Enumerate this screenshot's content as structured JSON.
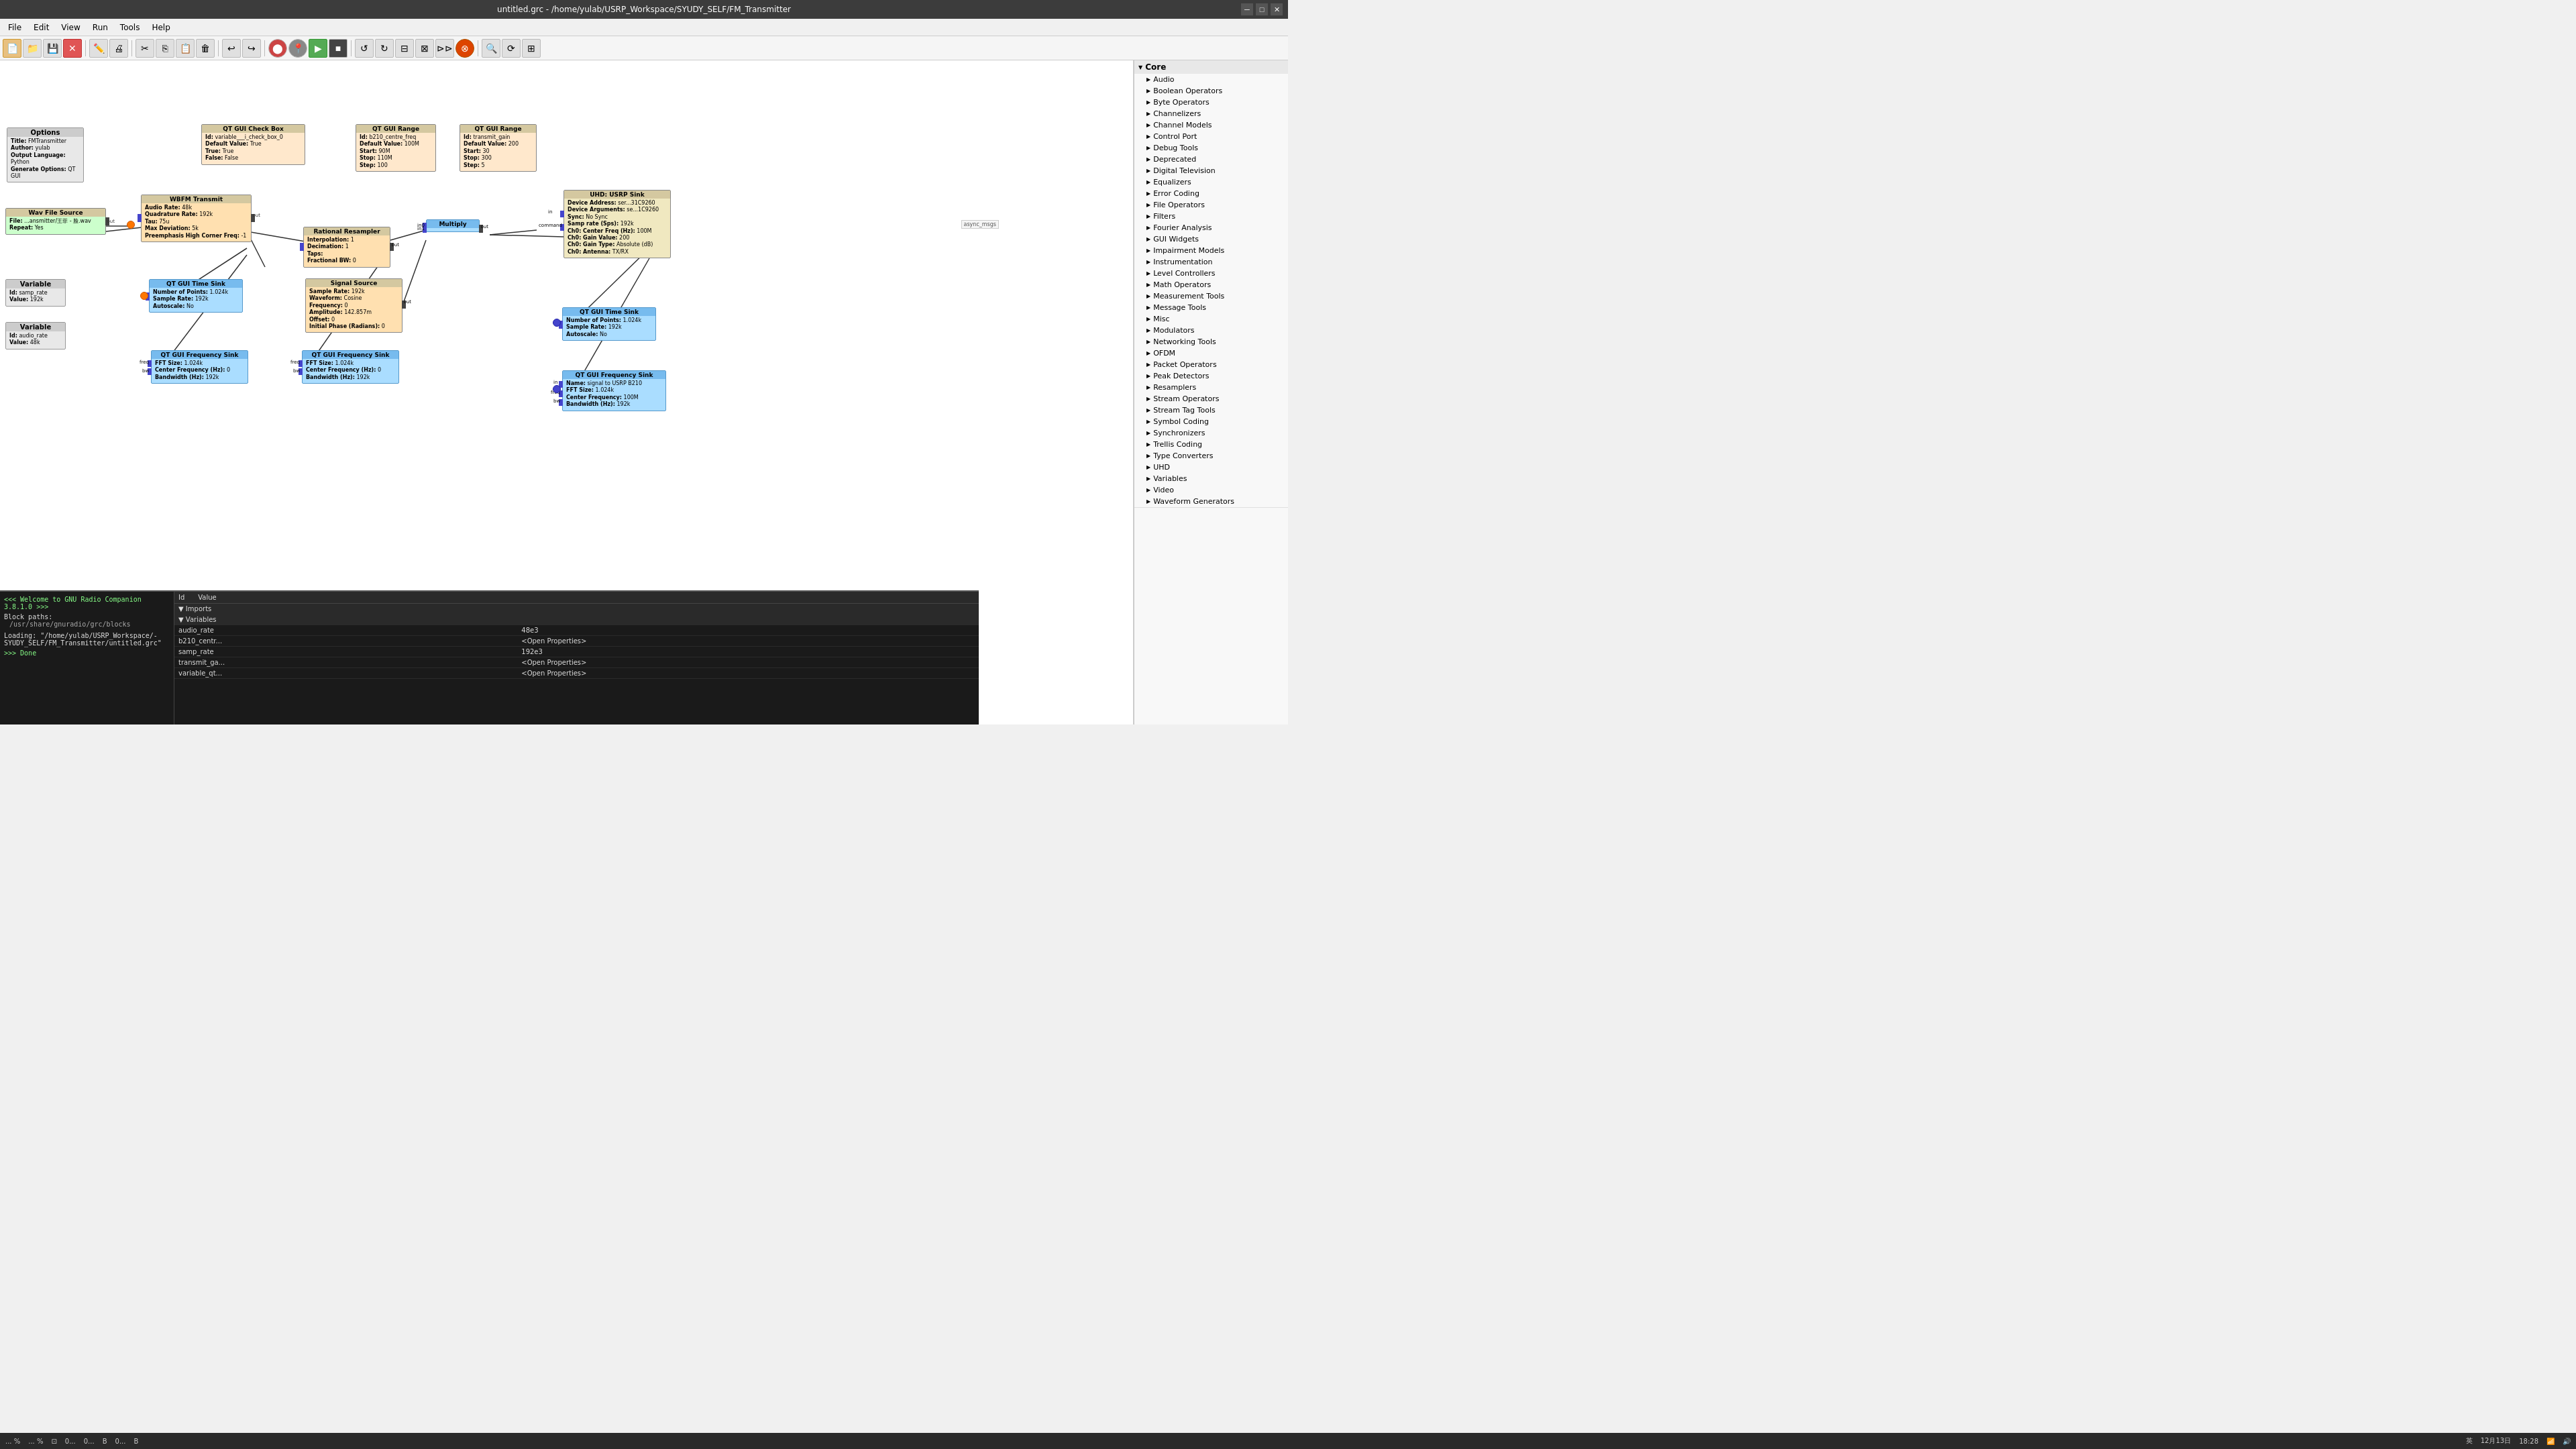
{
  "window": {
    "title": "untitled.grc - /home/yulab/USRP_Workspace/SYUDY_SELF/FM_Transmitter"
  },
  "menubar": {
    "items": [
      "File",
      "Edit",
      "View",
      "Run",
      "Tools",
      "Help"
    ]
  },
  "toolbar": {
    "buttons": [
      "new",
      "open",
      "save",
      "close",
      "edit",
      "print",
      "cut",
      "copy",
      "paste",
      "delete",
      "undo",
      "redo",
      "stop",
      "enable",
      "play",
      "stop2",
      "skip",
      "back",
      "forward",
      "rotate-left",
      "rotate-right",
      "connect",
      "disconnect",
      "search",
      "refresh",
      "align"
    ]
  },
  "blocks": {
    "options": {
      "title": "Options",
      "fields": [
        {
          "label": "Title:",
          "value": "FMTransmitter"
        },
        {
          "label": "Author:",
          "value": "yulab"
        },
        {
          "label": "Output Language:",
          "value": "Python"
        },
        {
          "label": "Generate Options:",
          "value": "QT GUI"
        }
      ]
    },
    "wav_source": {
      "title": "Wav File Source",
      "fields": [
        {
          "label": "File:",
          "value": "...ansmitter/王菲 - 脸.wav"
        },
        {
          "label": "Repeat:",
          "value": "Yes"
        }
      ]
    },
    "variable1": {
      "title": "Variable",
      "fields": [
        {
          "label": "Id:",
          "value": "samp_rate"
        },
        {
          "label": "Value:",
          "value": "192k"
        }
      ]
    },
    "variable2": {
      "title": "Variable",
      "fields": [
        {
          "label": "Id:",
          "value": "audio_rate"
        },
        {
          "label": "Value:",
          "value": "48k"
        }
      ]
    },
    "wbfm": {
      "title": "WBFM Transmit",
      "fields": [
        {
          "label": "Audio Rate:",
          "value": "48k"
        },
        {
          "label": "Quadrature Rate:",
          "value": "192k"
        },
        {
          "label": "Tau:",
          "value": "75u"
        },
        {
          "label": "Max Deviation:",
          "value": "5k"
        },
        {
          "label": "Preemphasis High Corner Freq:",
          "value": "-1"
        }
      ]
    },
    "qt_checkbox": {
      "title": "QT GUI Check Box",
      "fields": [
        {
          "label": "Id:",
          "value": "variable___i_check_box_0"
        },
        {
          "label": "Default Value:",
          "value": "True"
        },
        {
          "label": "True:",
          "value": "True"
        },
        {
          "label": "False:",
          "value": "False"
        }
      ]
    },
    "qt_range1": {
      "title": "QT GUI Range",
      "fields": [
        {
          "label": "Id:",
          "value": "b210_centre_freq"
        },
        {
          "label": "Default Value:",
          "value": "100M"
        },
        {
          "label": "Start:",
          "value": "90M"
        },
        {
          "label": "Stop:",
          "value": "110M"
        },
        {
          "label": "Step:",
          "value": "100"
        }
      ]
    },
    "qt_range2": {
      "title": "QT GUI Range",
      "fields": [
        {
          "label": "Id:",
          "value": "transmit_gain"
        },
        {
          "label": "Default Value:",
          "value": "200"
        },
        {
          "label": "Start:",
          "value": "30"
        },
        {
          "label": "Stop:",
          "value": "300"
        },
        {
          "label": "Step:",
          "value": "5"
        }
      ]
    },
    "rational_resampler": {
      "title": "Rational Resampler",
      "fields": [
        {
          "label": "Interpolation:",
          "value": "1"
        },
        {
          "label": "Decimation:",
          "value": "1"
        },
        {
          "label": "Taps:",
          "value": ""
        },
        {
          "label": "Fractional BW:",
          "value": "0"
        }
      ]
    },
    "signal_source": {
      "title": "Signal Source",
      "fields": [
        {
          "label": "Sample Rate:",
          "value": "192k"
        },
        {
          "label": "Waveform:",
          "value": "Cosine"
        },
        {
          "label": "Frequency:",
          "value": "0"
        },
        {
          "label": "Amplitude:",
          "value": "142.857m"
        },
        {
          "label": "Offset:",
          "value": "0"
        },
        {
          "label": "Initial Phase (Radians):",
          "value": "0"
        }
      ]
    },
    "multiply": {
      "title": "Multiply",
      "ports_in": [
        "in0",
        "in1"
      ]
    },
    "usrp_sink": {
      "title": "UHD: USRP Sink",
      "fields": [
        {
          "label": "Device Address:",
          "value": "ser...31C9260"
        },
        {
          "label": "Device Arguments:",
          "value": "se...1C9260"
        },
        {
          "label": "Sync:",
          "value": "No Sync"
        },
        {
          "label": "Samp rate (Sps):",
          "value": "192k"
        },
        {
          "label": "Ch0: Center Freq (Hz):",
          "value": "100M"
        },
        {
          "label": "Ch0: Gain Value:",
          "value": "200"
        },
        {
          "label": "Ch0: Gain Type:",
          "value": "Absolute (dB)"
        },
        {
          "label": "Ch0: Antenna:",
          "value": "TX/RX"
        }
      ]
    },
    "qt_time_sink1": {
      "title": "QT GUI Time Sink",
      "fields": [
        {
          "label": "Number of Points:",
          "value": "1.024k"
        },
        {
          "label": "Sample Rate:",
          "value": "192k"
        },
        {
          "label": "Autoscale:",
          "value": "No"
        }
      ]
    },
    "qt_time_sink2": {
      "title": "QT GUI Time Sink",
      "fields": [
        {
          "label": "Number of Points:",
          "value": "1.024k"
        },
        {
          "label": "Sample Rate:",
          "value": "192k"
        },
        {
          "label": "Autoscale:",
          "value": "No"
        }
      ]
    },
    "qt_freq_sink1": {
      "title": "QT GUI Frequency Sink",
      "fields": [
        {
          "label": "FFT Size:",
          "value": "1.024k"
        },
        {
          "label": "Center Frequency (Hz):",
          "value": "0"
        },
        {
          "label": "Bandwidth (Hz):",
          "value": "192k"
        }
      ]
    },
    "qt_freq_sink2": {
      "title": "QT GUI Frequency Sink",
      "fields": [
        {
          "label": "FFT Size:",
          "value": "1.024k"
        },
        {
          "label": "Center Frequency (Hz):",
          "value": "0"
        },
        {
          "label": "Bandwidth (Hz):",
          "value": "192k"
        }
      ]
    },
    "qt_freq_sink3": {
      "title": "QT GUI Frequency Sink",
      "fields": [
        {
          "label": "Name:",
          "value": "signal to USRP B210"
        },
        {
          "label": "FFT Size:",
          "value": "1.024k"
        },
        {
          "label": "Center Frequency:",
          "value": "100M"
        },
        {
          "label": "Bandwidth (Hz):",
          "value": "192k"
        }
      ]
    }
  },
  "sidebar": {
    "core_label": "Core",
    "items": [
      {
        "label": "Audio",
        "expandable": true
      },
      {
        "label": "Boolean Operators",
        "expandable": true
      },
      {
        "label": "Byte Operators",
        "expandable": true
      },
      {
        "label": "Channelizers",
        "expandable": true
      },
      {
        "label": "Channel Models",
        "expandable": true
      },
      {
        "label": "Control Port",
        "expandable": true
      },
      {
        "label": "Debug Tools",
        "expandable": true
      },
      {
        "label": "Deprecated",
        "expandable": true
      },
      {
        "label": "Digital Television",
        "expandable": true
      },
      {
        "label": "Equalizers",
        "expandable": true
      },
      {
        "label": "Error Coding",
        "expandable": true
      },
      {
        "label": "File Operators",
        "expandable": true
      },
      {
        "label": "Filters",
        "expandable": true
      },
      {
        "label": "Fourier Analysis",
        "expandable": true
      },
      {
        "label": "GUI Widgets",
        "expandable": true
      },
      {
        "label": "Impairment Models",
        "expandable": true
      },
      {
        "label": "Instrumentation",
        "expandable": true
      },
      {
        "label": "Level Controllers",
        "expandable": true
      },
      {
        "label": "Math Operators",
        "expandable": true
      },
      {
        "label": "Measurement Tools",
        "expandable": true
      },
      {
        "label": "Message Tools",
        "expandable": true
      },
      {
        "label": "Misc",
        "expandable": true
      },
      {
        "label": "Modulators",
        "expandable": true
      },
      {
        "label": "Networking Tools",
        "expandable": true
      },
      {
        "label": "OFDM",
        "expandable": true
      },
      {
        "label": "Packet Operators",
        "expandable": true
      },
      {
        "label": "Peak Detectors",
        "expandable": true
      },
      {
        "label": "Resamplers",
        "expandable": true
      },
      {
        "label": "Stream Operators",
        "expandable": true
      },
      {
        "label": "Stream Tag Tools",
        "expandable": true
      },
      {
        "label": "Symbol Coding",
        "expandable": true
      },
      {
        "label": "Synchronizers",
        "expandable": true
      },
      {
        "label": "Trellis Coding",
        "expandable": true
      },
      {
        "label": "Type Converters",
        "expandable": true
      },
      {
        "label": "UHD",
        "expandable": true
      },
      {
        "label": "Variables",
        "expandable": true
      },
      {
        "label": "Video",
        "expandable": true
      },
      {
        "label": "Waveform Generators",
        "expandable": true
      }
    ]
  },
  "console": {
    "welcome": "<<< Welcome to GNU Radio Companion 3.8.1.0 >>>",
    "block_paths_label": "Block paths:",
    "block_paths_value": "/usr/share/gnuradio/grc/blocks",
    "loading": "Loading: \"/home/yulab/USRP_Workspace/-SYUDY_SELF/FM_Transmitter/untitled.grc\"",
    "done": ">>> Done"
  },
  "props_table": {
    "col_id": "Id",
    "col_value": "Value",
    "sections": [
      {
        "type": "section",
        "label": "Imports"
      },
      {
        "type": "section",
        "label": "Variables"
      },
      {
        "type": "row",
        "id": "audio_rate",
        "value": "48e3"
      },
      {
        "type": "row",
        "id": "b210_centr...",
        "value": "<Open Properties>",
        "is_link": true
      },
      {
        "type": "row",
        "id": "samp_rate",
        "value": "192e3"
      },
      {
        "type": "row",
        "id": "transmit_ga...",
        "value": "<Open Properties>",
        "is_link": true
      },
      {
        "type": "row",
        "id": "variable_qt...",
        "value": "<Open Properties>",
        "is_link": true
      }
    ]
  },
  "statusbar": {
    "items": [
      "... %",
      "... %",
      "...",
      "0...",
      "0...",
      "B",
      "0...",
      "B",
      "英",
      "12月13日",
      "18:28"
    ]
  }
}
